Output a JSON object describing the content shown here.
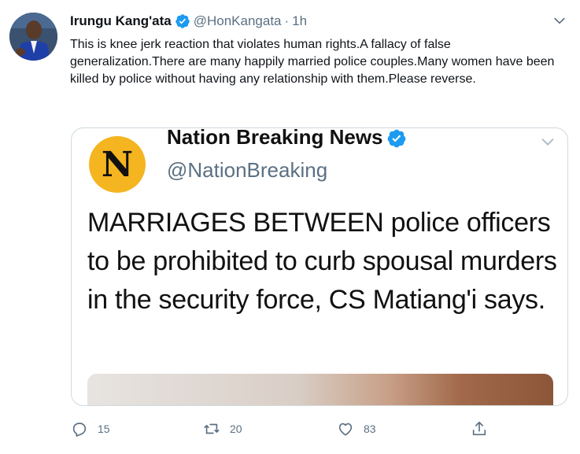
{
  "tweet": {
    "display_name": "Irungu Kang'ata",
    "handle": "@HonKangata",
    "separator": "·",
    "time": "1h",
    "text": "This is knee jerk reaction that violates human rights.A fallacy of false generalization.There are many happily married police couples.Many women have been killed by police without having any relationship with them.Please reverse."
  },
  "quote": {
    "logo_letter": "N",
    "display_name": "Nation Breaking News",
    "handle": "@NationBreaking",
    "headline": "MARRIAGES BETWEEN police officers to be prohibited to curb spousal murders in the security force, CS Matiang'i says."
  },
  "actions": {
    "reply_count": "15",
    "retweet_count": "20",
    "like_count": "83"
  },
  "colors": {
    "verified": "#1d9bf0",
    "secondary_text": "#5b7083",
    "logo_bg": "#f4b521",
    "card_border": "#cfd9de"
  },
  "icons": [
    "verified-badge-icon",
    "chevron-down-icon",
    "reply-icon",
    "retweet-icon",
    "like-icon",
    "share-icon"
  ]
}
